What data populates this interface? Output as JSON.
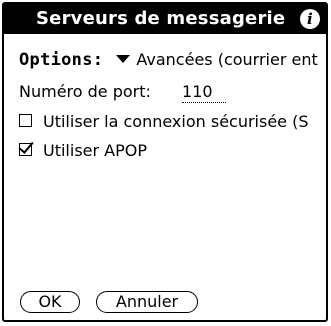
{
  "dialog": {
    "title": "Serveurs de messagerie",
    "info_icon": "info-icon"
  },
  "options": {
    "label": "Options:",
    "selected": "Avancées (courrier ent",
    "dropdown_icon": "triangle-down-icon"
  },
  "port": {
    "label": "Numéro de port:",
    "value": "110"
  },
  "checkboxes": [
    {
      "label": "Utiliser la connexion sécurisée (S",
      "checked": false
    },
    {
      "label": "Utiliser APOP",
      "checked": true
    }
  ],
  "buttons": {
    "ok_label": "OK",
    "cancel_label": "Annuler"
  }
}
